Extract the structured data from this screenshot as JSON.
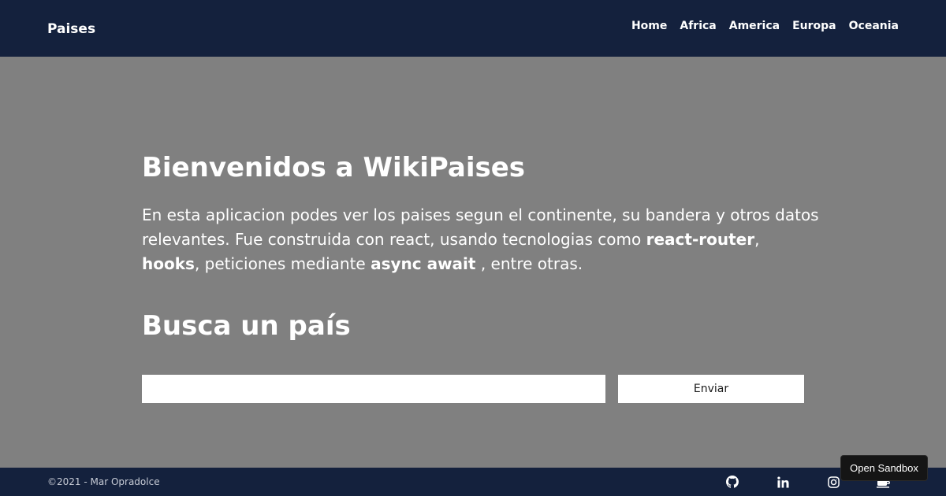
{
  "navbar": {
    "brand": "Paises",
    "links": [
      "Home",
      "Africa",
      "America",
      "Europa",
      "Oceania"
    ]
  },
  "main": {
    "title": "Bienvenidos a WikiPaises",
    "intro": {
      "p1": "En esta aplicacion podes ver los paises segun el continente, su bandera y otros datos relevantes. Fue construida con react, usando tecnologias como ",
      "b1": "react-router",
      "p2": ",",
      "b2": "hooks",
      "p3": ", peticiones mediante ",
      "b3": "async await",
      "p4": " , entre otras."
    },
    "search_title": "Busca un país",
    "search": {
      "value": "",
      "button_label": "Enviar"
    }
  },
  "footer": {
    "copyright": "©2021 - Mar Opradolce",
    "socials": [
      "github-icon",
      "linkedin-icon",
      "instagram-icon",
      "coffee-icon"
    ]
  },
  "sandbox_button": "Open Sandbox",
  "colors": {
    "navbar": "#14213d",
    "background": "#808080",
    "text": "#ffffff"
  }
}
